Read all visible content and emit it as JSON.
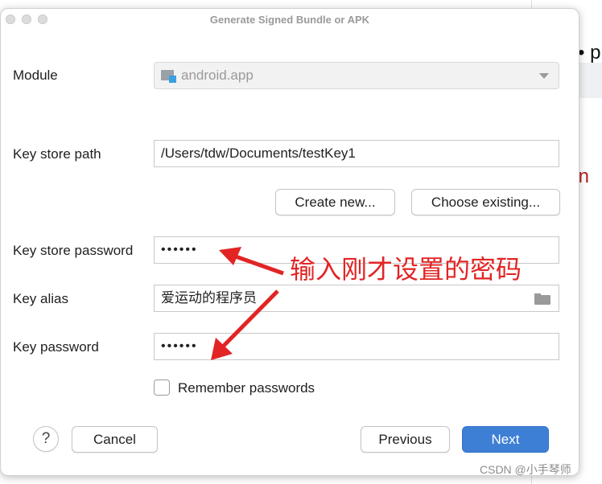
{
  "background": {
    "fragment1": "• p",
    "fragment2": "\"",
    "fragment3": "gin"
  },
  "window": {
    "title": "Generate Signed Bundle or APK"
  },
  "module": {
    "label": "Module",
    "value": "android.app"
  },
  "key_store": {
    "path_label": "Key store path",
    "path_value": "/Users/tdw/Documents/testKey1",
    "create_new_label": "Create new...",
    "choose_existing_label": "Choose existing...",
    "password_label": "Key store password",
    "password_mask": "••••••"
  },
  "key": {
    "alias_label": "Key alias",
    "alias_value": "爱运动的程序员",
    "password_label": "Key password",
    "password_mask": "••••••"
  },
  "remember": {
    "label": "Remember passwords",
    "checked": false
  },
  "footer": {
    "help_label": "?",
    "cancel_label": "Cancel",
    "previous_label": "Previous",
    "next_label": "Next"
  },
  "annotation": {
    "text": "输入刚才设置的密码",
    "color": "#e22424"
  },
  "watermark": "CSDN @小手琴师",
  "colors": {
    "primary": "#3e7fd6"
  }
}
